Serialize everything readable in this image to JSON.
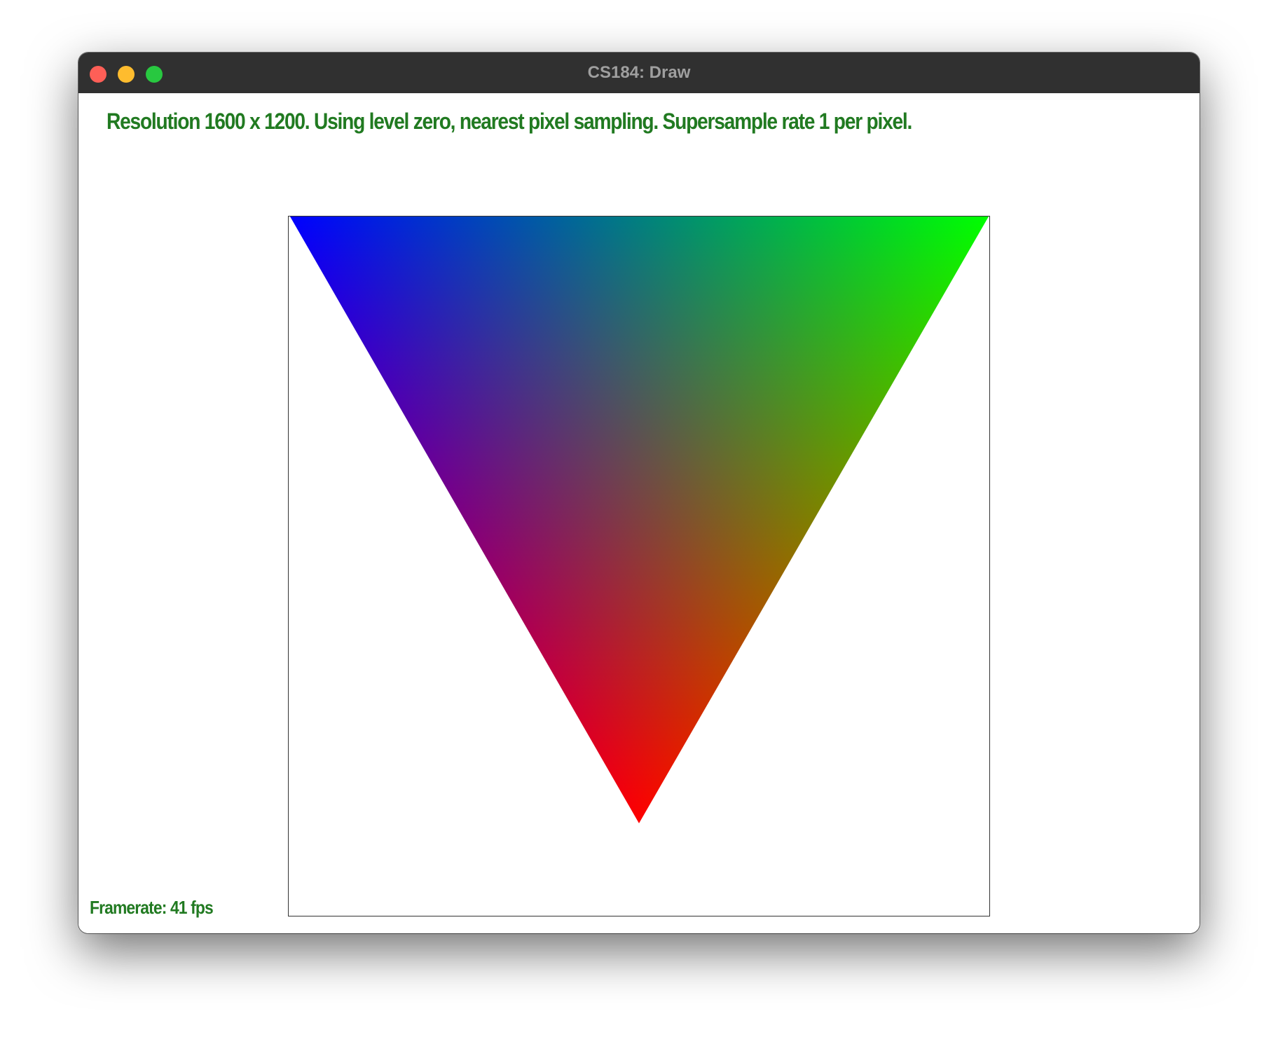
{
  "window": {
    "title": "CS184: Draw"
  },
  "overlay": {
    "status": "Resolution 1600 x 1200. Using level zero, nearest pixel sampling. Supersample rate 1 per pixel.",
    "framerate": "Framerate: 41 fps"
  },
  "colors": {
    "overlay_text": "#217a21",
    "titlebar": "#303030",
    "vertex_top_left": "#0000ff",
    "vertex_top_right": "#00ff00",
    "vertex_bottom": "#ff0000"
  },
  "icons": [
    "close-icon",
    "minimize-icon",
    "maximize-icon"
  ]
}
